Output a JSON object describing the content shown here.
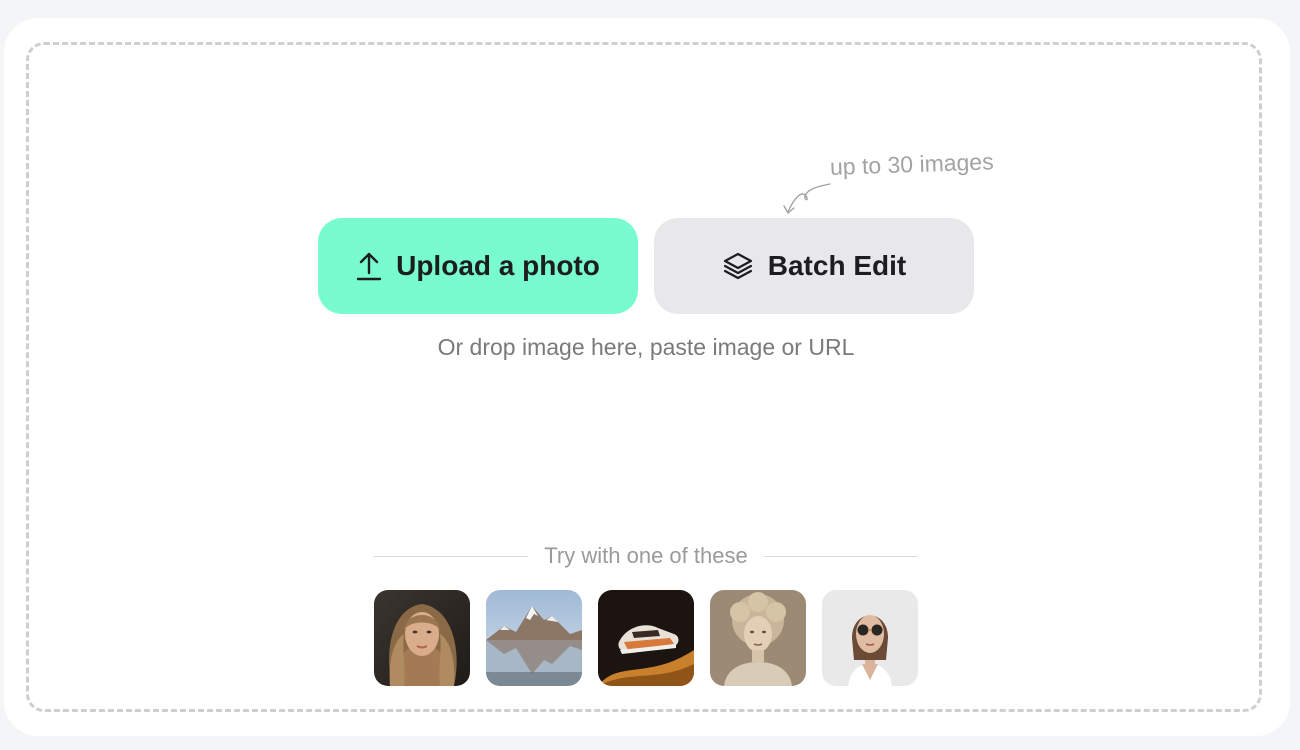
{
  "uploader": {
    "hint": "up to 30 images",
    "upload_label": "Upload a photo",
    "batch_label": "Batch Edit",
    "drop_text": "Or drop image here, paste image or URL",
    "try_label": "Try with one of these"
  },
  "samples": [
    {
      "icon": "portrait-woman-sample"
    },
    {
      "icon": "mountain-lake-sample"
    },
    {
      "icon": "sneaker-sample"
    },
    {
      "icon": "vintage-portrait-sample"
    },
    {
      "icon": "sunglasses-woman-sample"
    }
  ],
  "colors": {
    "upload_bg": "#78fccf",
    "batch_bg": "#e8e8ea",
    "dashed_border": "#cfcfcf",
    "page_bg": "#f4f5f7"
  }
}
